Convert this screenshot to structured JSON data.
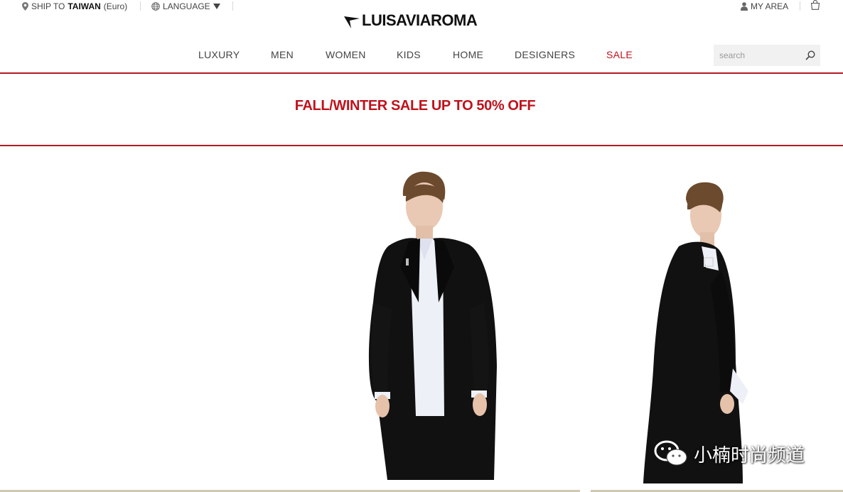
{
  "topbar": {
    "ship_prefix": "SHIP TO",
    "ship_country": "TAIWAN",
    "ship_currency": "(Euro)",
    "language_label": "LANGUAGE",
    "my_area_label": "MY AREA"
  },
  "logo": {
    "text": "LUISAVIAROMA"
  },
  "nav": {
    "items": [
      {
        "label": "LUXURY"
      },
      {
        "label": "MEN"
      },
      {
        "label": "WOMEN"
      },
      {
        "label": "KIDS"
      },
      {
        "label": "HOME"
      },
      {
        "label": "DESIGNERS"
      },
      {
        "label": "SALE"
      }
    ]
  },
  "search": {
    "placeholder": "search"
  },
  "banner": {
    "text": "FALL/WINTER SALE UP TO 50% OFF"
  },
  "watermark": {
    "text": "小楠时尚频道"
  },
  "colors": {
    "accent": "#c0121c",
    "rule": "#b01e24",
    "search_bg": "#f1f1f1"
  },
  "icons": [
    "location-pin-icon",
    "globe-icon",
    "caret-down-icon",
    "user-icon",
    "shopping-bag-icon",
    "search-icon",
    "wechat-icon"
  ]
}
